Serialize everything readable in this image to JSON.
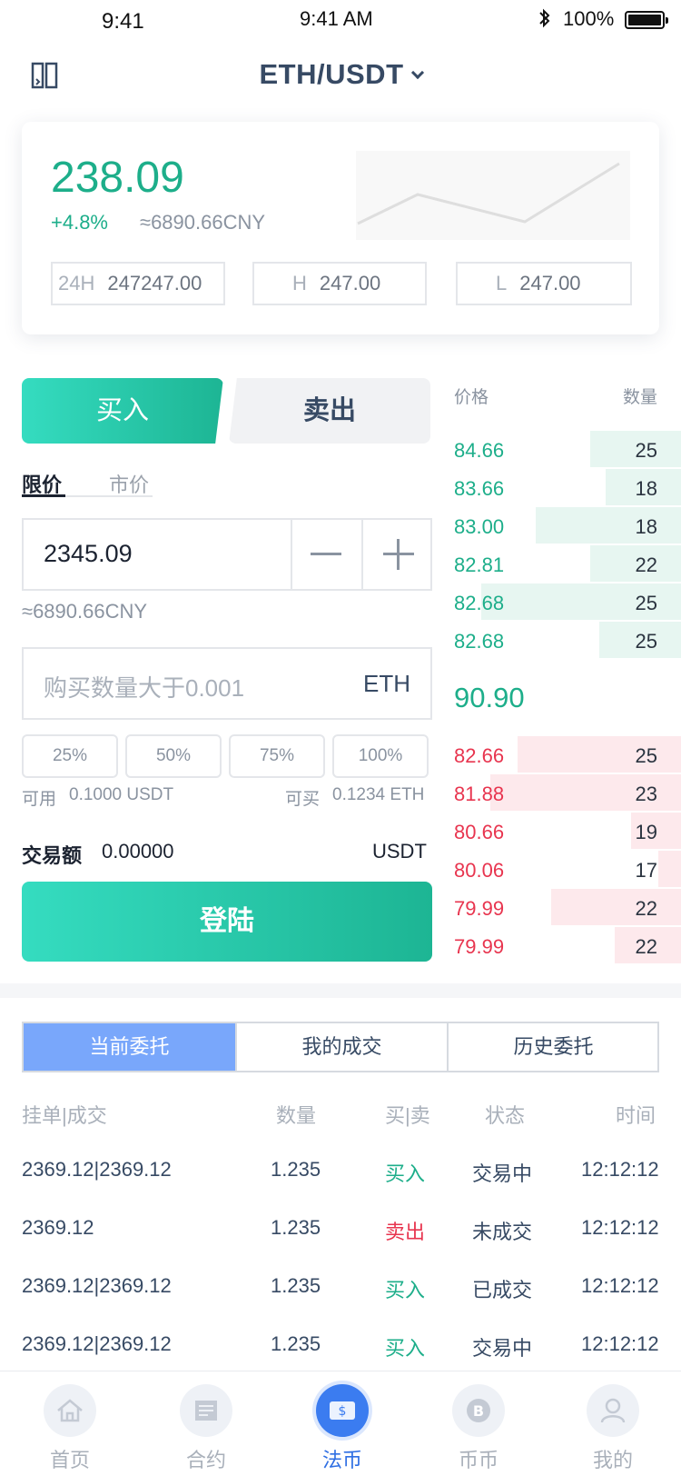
{
  "status_bar": {
    "time_left": "9:41",
    "time_center": "9:41 AM",
    "battery": "100%"
  },
  "header": {
    "pair": "ETH/USDT"
  },
  "ticker": {
    "price": "238.09",
    "change": "+4.8%",
    "cny": "≈6890.66CNY",
    "stats": [
      {
        "key": "24H",
        "value": "247247.00"
      },
      {
        "key": "H",
        "value": "247.00"
      },
      {
        "key": "L",
        "value": "247.00"
      }
    ]
  },
  "trade": {
    "buy_tab": "买入",
    "sell_tab": "卖出",
    "order_types": [
      "限价",
      "市价"
    ],
    "price_value": "2345.09",
    "approx_cny": "≈6890.66CNY",
    "qty_placeholder": "购买数量大于0.001",
    "qty_unit": "ETH",
    "percents": [
      "25%",
      "50%",
      "75%",
      "100%"
    ],
    "available_label": "可用",
    "available_value": "0.1000 USDT",
    "can_buy_label": "可买",
    "can_buy_value": "0.1234 ETH",
    "amount_label": "交易额",
    "amount_value": "0.00000",
    "amount_unit": "USDT",
    "login_button": "登陆"
  },
  "orderbook": {
    "price_header": "价格",
    "qty_header": "数量",
    "mid_price": "90.90",
    "asks_green": [
      {
        "price": "84.66",
        "qty": "25",
        "depth": 0.4
      },
      {
        "price": "83.66",
        "qty": "18",
        "depth": 0.33
      },
      {
        "price": "83.00",
        "qty": "18",
        "depth": 0.64
      },
      {
        "price": "82.81",
        "qty": "22",
        "depth": 0.4
      },
      {
        "price": "82.68",
        "qty": "25",
        "depth": 0.88
      },
      {
        "price": "82.68",
        "qty": "25",
        "depth": 0.36
      }
    ],
    "bids_red": [
      {
        "price": "82.66",
        "qty": "25",
        "depth": 0.72
      },
      {
        "price": "81.88",
        "qty": "23",
        "depth": 0.84
      },
      {
        "price": "80.66",
        "qty": "19",
        "depth": 0.22
      },
      {
        "price": "80.06",
        "qty": "17",
        "depth": 0.1
      },
      {
        "price": "79.99",
        "qty": "22",
        "depth": 0.57
      },
      {
        "price": "79.99",
        "qty": "22",
        "depth": 0.29
      }
    ]
  },
  "orders": {
    "tabs": [
      "当前委托",
      "我的成交",
      "历史委托"
    ],
    "columns": [
      "挂单|成交",
      "数量",
      "买|卖",
      "状态",
      "时间"
    ],
    "rows": [
      {
        "price": "2369.12|2369.12",
        "qty": "1.235",
        "side": "买入",
        "side_type": "buy",
        "status": "交易中",
        "time": "12:12:12"
      },
      {
        "price": "2369.12",
        "qty": "1.235",
        "side": "卖出",
        "side_type": "sell",
        "status": "未成交",
        "time": "12:12:12"
      },
      {
        "price": "2369.12|2369.12",
        "qty": "1.235",
        "side": "买入",
        "side_type": "buy",
        "status": "已成交",
        "time": "12:12:12"
      },
      {
        "price": "2369.12|2369.12",
        "qty": "1.235",
        "side": "买入",
        "side_type": "buy",
        "status": "交易中",
        "time": "12:12:12"
      }
    ]
  },
  "tabbar": [
    {
      "label": "首页",
      "icon": "home-icon"
    },
    {
      "label": "合约",
      "icon": "contract-icon"
    },
    {
      "label": "法币",
      "icon": "fiat-icon"
    },
    {
      "label": "币币",
      "icon": "bitcoin-icon"
    },
    {
      "label": "我的",
      "icon": "profile-icon"
    }
  ],
  "colors": {
    "up": "#1dae8a",
    "down": "#e8354f",
    "accent": "#3b7cf0"
  }
}
